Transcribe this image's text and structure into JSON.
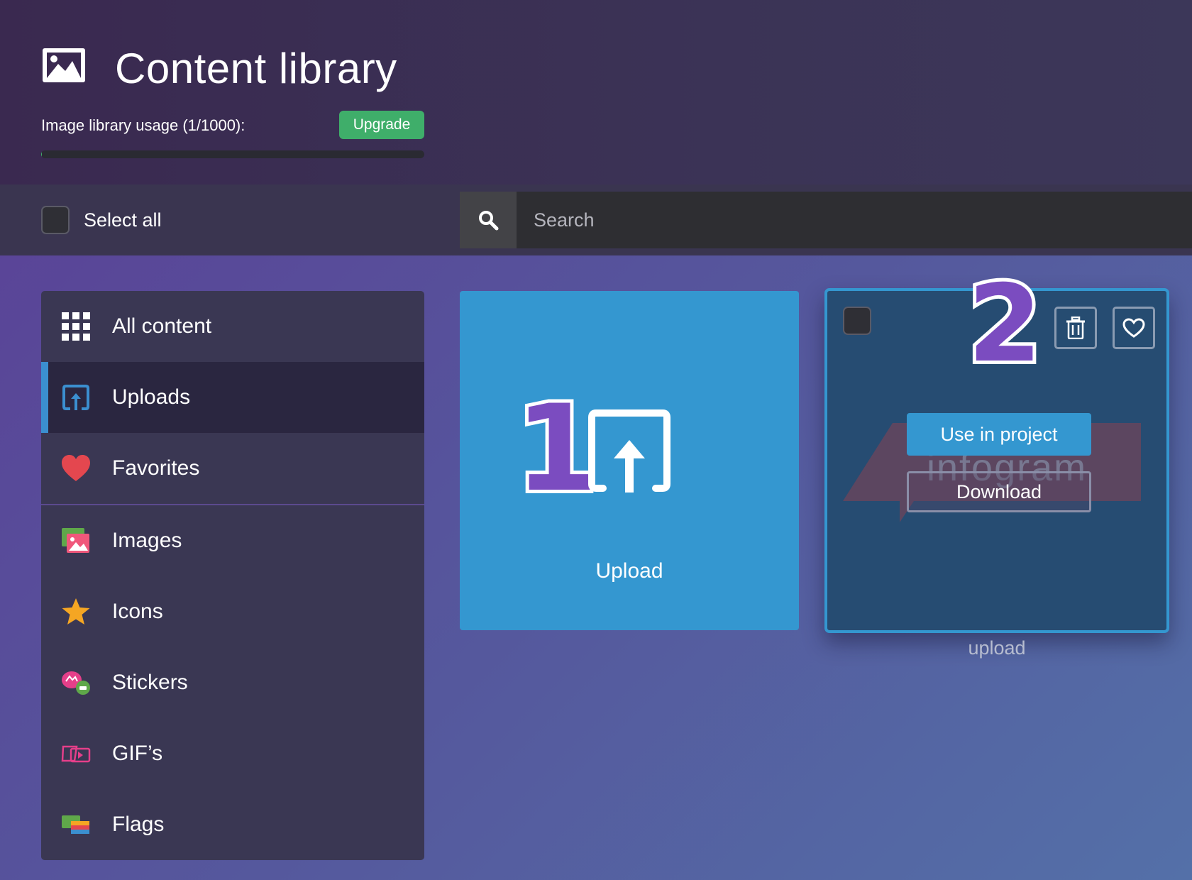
{
  "header": {
    "title": "Content library",
    "title_icon": "image-icon",
    "usage_label": "Image library usage (1/1000):",
    "usage_progress": 0.001,
    "upgrade_label": "Upgrade"
  },
  "toolbar": {
    "select_all_label": "Select all",
    "search_placeholder": "Search",
    "search_icon": "search-icon"
  },
  "sidebar": {
    "items": [
      {
        "label": "All content",
        "icon": "grid-icon",
        "active": false
      },
      {
        "label": "Uploads",
        "icon": "upload-icon",
        "active": true
      },
      {
        "label": "Favorites",
        "icon": "heart-icon",
        "active": false
      },
      {
        "label": "Images",
        "icon": "images-icon",
        "active": false
      },
      {
        "label": "Icons",
        "icon": "star-icon",
        "active": false
      },
      {
        "label": "Stickers",
        "icon": "sticker-icon",
        "active": false
      },
      {
        "label": "GIF’s",
        "icon": "gif-icon",
        "active": false
      },
      {
        "label": "Flags",
        "icon": "flag-icon",
        "active": false
      }
    ]
  },
  "upload_card": {
    "label": "Upload",
    "step_number": "1"
  },
  "item_card": {
    "step_number": "2",
    "watermark": "infogram",
    "use_label": "Use in project",
    "download_label": "Download",
    "caption": "upload"
  },
  "colors": {
    "accent_blue": "#3497d0",
    "upgrade_green": "#3fae6a",
    "step_purple": "#7b4cc0"
  }
}
